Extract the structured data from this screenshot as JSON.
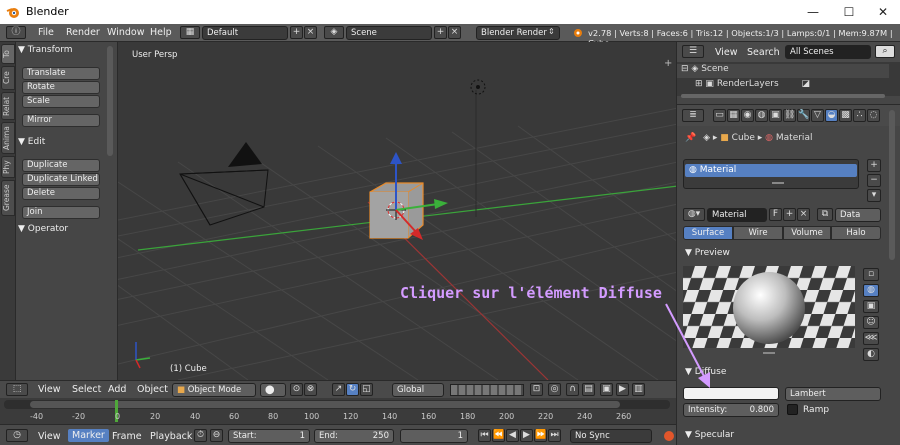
{
  "window": {
    "title": "Blender",
    "minimize": "—",
    "maximize": "☐",
    "close": "✕"
  },
  "menu": {
    "items": [
      "File",
      "Render",
      "Window",
      "Help"
    ],
    "screen_layout": "Default",
    "scene": "Scene",
    "engine": "Blender Render",
    "stats": "v2.78 | Verts:8 | Faces:6 | Tris:12 | Objects:1/3 | Lamps:0/1 | Mem:9.87M | Cube"
  },
  "tool_tabs": [
    "To",
    "Cre",
    "Relat",
    "Anima",
    "Phy",
    "Grease"
  ],
  "toolshelf": {
    "transform": {
      "title": "Transform",
      "buttons": [
        "Translate",
        "Rotate",
        "Scale",
        "Mirror"
      ]
    },
    "edit": {
      "title": "Edit",
      "buttons": [
        "Duplicate",
        "Duplicate Linked",
        "Delete",
        "Join"
      ]
    },
    "operator": {
      "title": "Operator"
    }
  },
  "viewport": {
    "view_label": "User Persp",
    "object_label": "(1) Cube"
  },
  "view3d_header": {
    "menus": [
      "View",
      "Select",
      "Add",
      "Object"
    ],
    "mode": "Object Mode",
    "orientation": "Global"
  },
  "timeline": {
    "ticks": [
      "-40",
      "-20",
      "0",
      "20",
      "40",
      "60",
      "80",
      "100",
      "120",
      "140",
      "160",
      "180",
      "200",
      "220",
      "240",
      "260"
    ],
    "menus": [
      "View",
      "Marker",
      "Frame",
      "Playback"
    ],
    "start_label": "Start:",
    "start": "1",
    "end_label": "End:",
    "end": "250",
    "current": "1",
    "sync": "No Sync"
  },
  "outliner": {
    "menus": [
      "View",
      "Search"
    ],
    "filter": "All Scenes",
    "rows": [
      "Scene",
      "RenderLayers"
    ]
  },
  "properties": {
    "breadcrumb": [
      "Cube",
      "Material"
    ],
    "slot": "Material",
    "material_name": "Material",
    "fake_user": "F",
    "link": "Data",
    "tabs": [
      "Surface",
      "Wire",
      "Volume",
      "Halo"
    ],
    "preview_title": "Preview",
    "diffuse_title": "Diffuse",
    "diffuse_shader": "Lambert",
    "intensity_label": "Intensity:",
    "intensity": "0.800",
    "ramp_label": "Ramp",
    "specular_title": "Specular"
  },
  "annotation": {
    "text": "Cliquer sur l'élément Diffuse",
    "color": "#d39bff"
  },
  "colors": {
    "accent": "#5680c2",
    "timeline_cursor": "#4fa83a"
  }
}
